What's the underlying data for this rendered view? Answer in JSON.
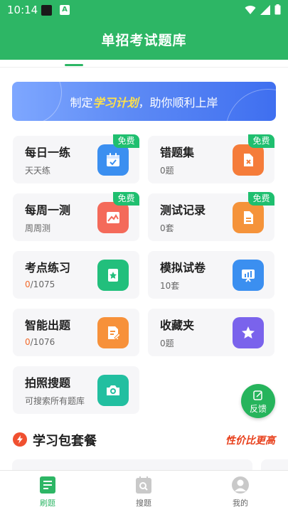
{
  "status_bar": {
    "time": "10:14"
  },
  "header": {
    "title": "单招考试题库"
  },
  "banner": {
    "prefix": "制定",
    "highlight": "学习计划",
    "suffix": "，助你顺利上岸"
  },
  "cards": [
    {
      "title": "每日一练",
      "sub": "天天练",
      "badge": "免费",
      "icon": "calendar-icon",
      "color": "#3b8ff0"
    },
    {
      "title": "错题集",
      "sub": "0题",
      "badge": "免费",
      "icon": "wrong-doc-icon",
      "color": "#f57c3a"
    },
    {
      "title": "每周一测",
      "sub": "周周测",
      "badge": "免费",
      "icon": "image-chart-icon",
      "color": "#f46a5a"
    },
    {
      "title": "测试记录",
      "sub": "0套",
      "badge": "免费",
      "icon": "document-icon",
      "color": "#f5933a"
    },
    {
      "title": "考点练习",
      "sub_highlight": "0",
      "sub_rest": "/1075",
      "icon": "star-book-icon",
      "color": "#22bf7c"
    },
    {
      "title": "模拟试卷",
      "sub": "10套",
      "icon": "presentation-icon",
      "color": "#3b8ff0"
    },
    {
      "title": "智能出题",
      "sub_highlight": "0",
      "sub_rest": "/1076",
      "icon": "edit-doc-icon",
      "color": "#f7913a"
    },
    {
      "title": "收藏夹",
      "sub": "0题",
      "icon": "star-icon",
      "color": "#7a63ec"
    },
    {
      "title": "拍照搜题",
      "sub": "可搜索所有题库",
      "icon": "camera-icon",
      "color": "#22bfa0"
    }
  ],
  "feedback": {
    "label": "反馈"
  },
  "section": {
    "title": "学习包套餐",
    "tag": "性价比更高"
  },
  "nav": [
    {
      "label": "刷题",
      "active": true
    },
    {
      "label": "搜题",
      "active": false
    },
    {
      "label": "我的",
      "active": false
    }
  ]
}
